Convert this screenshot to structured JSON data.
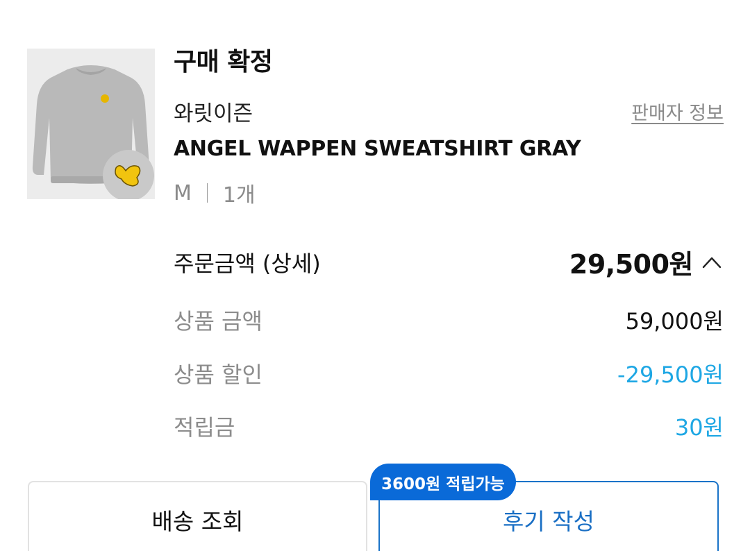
{
  "order": {
    "status": "구매 확정",
    "brand": "와릿이즌",
    "seller_link": "판매자 정보",
    "product_name": "ANGEL WAPPEN SWEATSHIRT GRAY",
    "option_size": "M",
    "option_qty": "1개",
    "thumbnail_icon": "sweatshirt-product-image"
  },
  "pricing": {
    "total_label": "주문금액 (상세)",
    "total_value": "29,500원",
    "total_toggle_icon": "chevron-up-icon",
    "lines": [
      {
        "label": "상품 금액",
        "value": "59,000원",
        "color": "#111111"
      },
      {
        "label": "상품 할인",
        "value": "-29,500원",
        "color": "#1ea7e4"
      },
      {
        "label": "적립금",
        "value": "30원",
        "color": "#1ea7e4"
      }
    ]
  },
  "actions": {
    "shipping_label": "배송 조회",
    "review_label": "후기 작성",
    "review_badge": "3600원 적립가능"
  },
  "colors": {
    "accent_blue": "#1a73c8",
    "badge_blue": "#0a6ad8",
    "discount_blue": "#1ea7e4"
  }
}
